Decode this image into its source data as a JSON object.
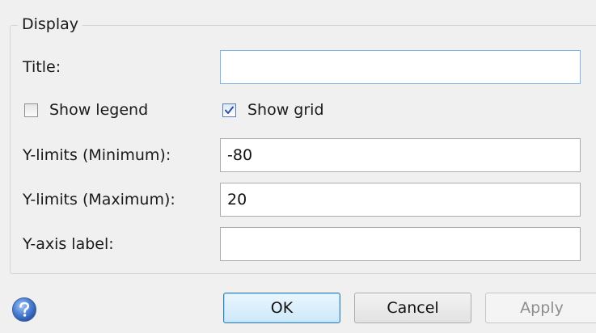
{
  "group": {
    "title": "Display"
  },
  "fields": {
    "title": {
      "label": "Title:",
      "value": ""
    },
    "ymin": {
      "label": "Y-limits (Minimum):",
      "value": "-80"
    },
    "ymax": {
      "label": "Y-limits (Maximum):",
      "value": "20"
    },
    "ylabel": {
      "label": "Y-axis label:",
      "value": ""
    }
  },
  "checkboxes": {
    "show_legend": {
      "label": "Show legend",
      "checked": false
    },
    "show_grid": {
      "label": "Show grid",
      "checked": true
    }
  },
  "buttons": {
    "ok": "OK",
    "cancel": "Cancel",
    "apply": "Apply"
  },
  "icons": {
    "help": "help-icon"
  },
  "colors": {
    "focus_border": "#7eb4ea",
    "default_button_border": "#3c7fb1",
    "help_icon": "#3a6fc4"
  }
}
